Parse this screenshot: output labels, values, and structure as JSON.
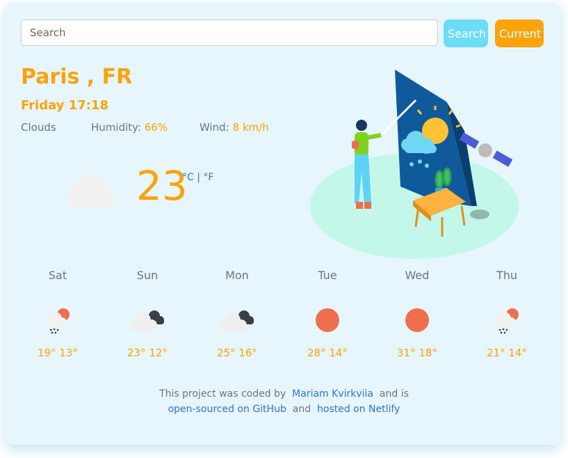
{
  "search": {
    "placeholder": "Search",
    "button_label": "Search",
    "current_label": "Current"
  },
  "weather": {
    "city": "Paris , FR",
    "datetime": "Friday 17:18",
    "description": "Clouds",
    "humidity_label": "Humidity:",
    "humidity_value": "66%",
    "wind_label": "Wind:",
    "wind_value": "8 km/h",
    "temperature": "23",
    "unit_c": "°C",
    "unit_sep": "|",
    "unit_f": "°F",
    "icon": "cloud-icon"
  },
  "forecast": [
    {
      "day": "Sat",
      "temps": "19° 13°",
      "icon": "rain-sun-icon"
    },
    {
      "day": "Sun",
      "temps": "23° 12°",
      "icon": "dark-clouds-icon"
    },
    {
      "day": "Mon",
      "temps": "25° 16°",
      "icon": "dark-clouds-icon"
    },
    {
      "day": "Tue",
      "temps": "28° 14°",
      "icon": "sun-icon"
    },
    {
      "day": "Wed",
      "temps": "31° 18°",
      "icon": "sun-icon"
    },
    {
      "day": "Thu",
      "temps": "21° 14°",
      "icon": "rain-sun-icon"
    }
  ],
  "footer": {
    "text1": "This project was coded by",
    "author_link": "Mariam Kvirkviia",
    "text2": "and is",
    "github_link": "open-sourced on GitHub",
    "text3": "and",
    "netlify_link": "hosted on Netlify"
  },
  "colors": {
    "accent": "#fca30a",
    "search_button": "#6cdcf7",
    "link": "#2b74d9",
    "card_bg": "#e6f6fc",
    "sun": "#ee6e4e"
  }
}
